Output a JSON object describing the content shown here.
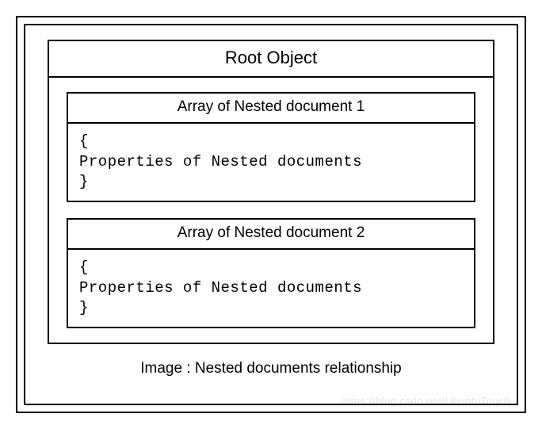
{
  "root": {
    "title": "Root Object",
    "nested": [
      {
        "title": "Array of Nested document 1",
        "body": "{\nProperties of Nested documents\n}"
      },
      {
        "title": "Array of Nested document 2",
        "body": "{\nProperties of Nested documents\n}"
      }
    ]
  },
  "caption": "Image : Nested documents relationship",
  "watermark": "https://blog.csdn.net/UbuntuTouch"
}
